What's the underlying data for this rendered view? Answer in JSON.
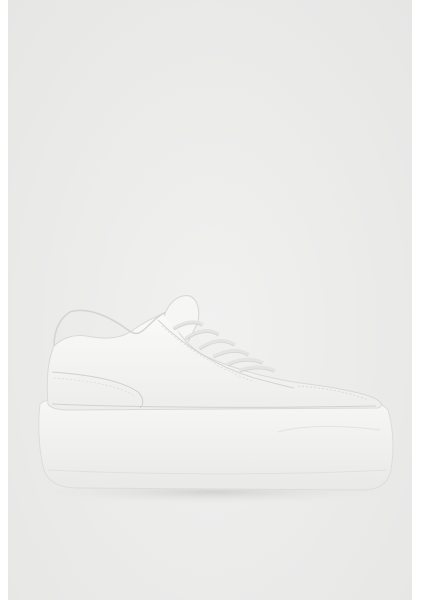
{
  "image": {
    "subject": "white-leather-low-top-sneaker-product-photo",
    "colors": {
      "backdrop": "#ececeb",
      "page_margin": "#ffffff",
      "shoe_upper": "#f4f4f3",
      "shoe_sole": "#f7f7f6",
      "stitch": "#cfcfce",
      "shadow": "#d6d6d5"
    }
  }
}
